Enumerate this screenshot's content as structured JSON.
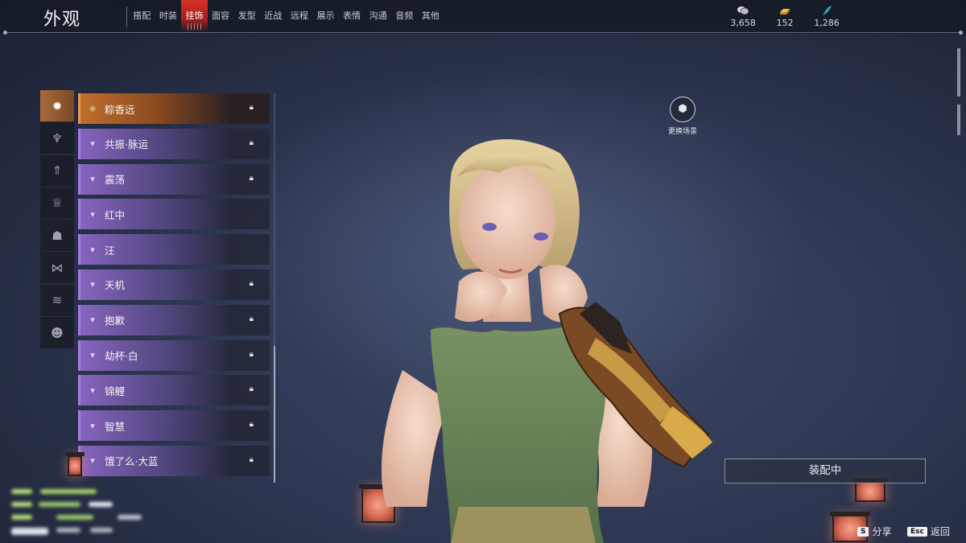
{
  "header": {
    "title": "外观",
    "tabs": [
      {
        "label": "搭配",
        "active": false
      },
      {
        "label": "时装",
        "active": false
      },
      {
        "label": "挂饰",
        "active": true
      },
      {
        "label": "面容",
        "active": false
      },
      {
        "label": "发型",
        "active": false
      },
      {
        "label": "近战",
        "active": false
      },
      {
        "label": "远程",
        "active": false
      },
      {
        "label": "展示",
        "active": false
      },
      {
        "label": "表情",
        "active": false
      },
      {
        "label": "沟通",
        "active": false
      },
      {
        "label": "音频",
        "active": false
      },
      {
        "label": "其他",
        "active": false
      }
    ],
    "currencies": [
      {
        "icon": "coin-stack-icon",
        "value": "3,658"
      },
      {
        "icon": "gold-bar-icon",
        "value": "152"
      },
      {
        "icon": "feather-icon",
        "value": "1,286"
      }
    ]
  },
  "categories": [
    {
      "icon": "spiky-mask-icon",
      "active": true
    },
    {
      "icon": "pendant-icon",
      "active": false
    },
    {
      "icon": "spear-emblem-icon",
      "active": false
    },
    {
      "icon": "crown-band-icon",
      "active": false
    },
    {
      "icon": "cloak-icon",
      "active": false
    },
    {
      "icon": "bow-tie-icon",
      "active": false
    },
    {
      "icon": "wings-icon",
      "active": false
    },
    {
      "icon": "demon-mask-icon",
      "active": false
    }
  ],
  "items": [
    {
      "name": "粽香远",
      "locked": true,
      "selected": true
    },
    {
      "name": "共振·脉运",
      "locked": true,
      "selected": false
    },
    {
      "name": "震荡",
      "locked": true,
      "selected": false
    },
    {
      "name": "红中",
      "locked": false,
      "selected": false
    },
    {
      "name": "汪",
      "locked": false,
      "selected": false
    },
    {
      "name": "天机",
      "locked": true,
      "selected": false
    },
    {
      "name": "抱歉",
      "locked": true,
      "selected": false
    },
    {
      "name": "劫杯·白",
      "locked": true,
      "selected": false
    },
    {
      "name": "锦鲤",
      "locked": true,
      "selected": false
    },
    {
      "name": "智慧",
      "locked": true,
      "selected": false
    },
    {
      "name": "饿了么·大蓝",
      "locked": true,
      "selected": false
    }
  ],
  "scene": {
    "label": "更换场景"
  },
  "equip": {
    "label": "装配中"
  },
  "footer": {
    "share_key": "S",
    "share_label": "分享",
    "back_key": "Esc",
    "back_label": "返回"
  },
  "colors": {
    "tab_active": "#d8322a",
    "item_rare": "#a57be0",
    "item_selected": "#c06f2c",
    "background": "#2d3650"
  }
}
